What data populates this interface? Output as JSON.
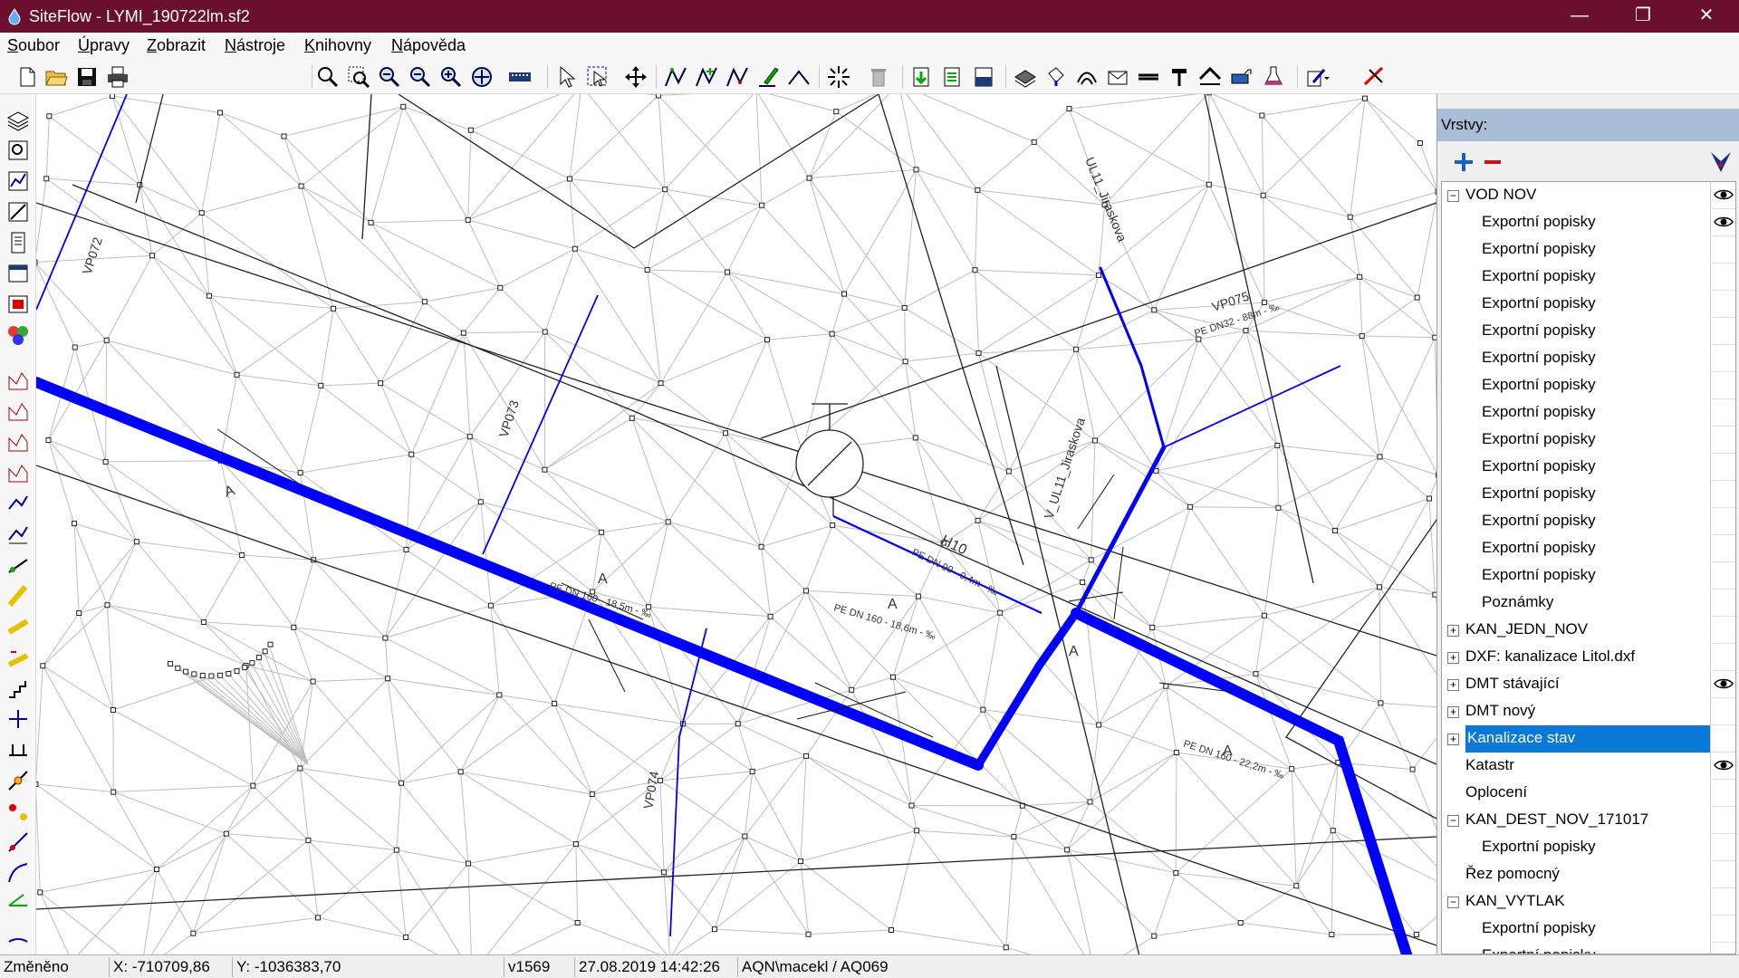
{
  "window": {
    "title": "SiteFlow - LYMI_190722lm.sf2"
  },
  "menu": [
    "Soubor",
    "Úpravy",
    "Zobrazit",
    "Nástroje",
    "Knihovny",
    "Nápověda"
  ],
  "layers": {
    "title": "Vrstvy:",
    "items": [
      {
        "label": "VOD NOV",
        "level": 0,
        "expander": "minus",
        "visible": true,
        "selected": false
      },
      {
        "label": "Exportní popisky",
        "level": 1,
        "visible": true,
        "selected": false
      },
      {
        "label": "Exportní popisky",
        "level": 1,
        "visible": false,
        "selected": false
      },
      {
        "label": "Exportní popisky",
        "level": 1,
        "visible": false,
        "selected": false
      },
      {
        "label": "Exportní popisky",
        "level": 1,
        "visible": false,
        "selected": false
      },
      {
        "label": "Exportní popisky",
        "level": 1,
        "visible": false,
        "selected": false
      },
      {
        "label": "Exportní popisky",
        "level": 1,
        "visible": false,
        "selected": false
      },
      {
        "label": "Exportní popisky",
        "level": 1,
        "visible": false,
        "selected": false
      },
      {
        "label": "Exportní popisky",
        "level": 1,
        "visible": false,
        "selected": false
      },
      {
        "label": "Exportní popisky",
        "level": 1,
        "visible": false,
        "selected": false
      },
      {
        "label": "Exportní popisky",
        "level": 1,
        "visible": false,
        "selected": false
      },
      {
        "label": "Exportní popisky",
        "level": 1,
        "visible": false,
        "selected": false
      },
      {
        "label": "Exportní popisky",
        "level": 1,
        "visible": false,
        "selected": false
      },
      {
        "label": "Exportní popisky",
        "level": 1,
        "visible": false,
        "selected": false
      },
      {
        "label": "Exportní popisky",
        "level": 1,
        "visible": false,
        "selected": false
      },
      {
        "label": "Poznámky",
        "level": 1,
        "visible": false,
        "selected": false
      },
      {
        "label": "KAN_JEDN_NOV",
        "level": 0,
        "expander": "plus",
        "visible": false,
        "selected": false
      },
      {
        "label": "DXF: kanalizace Litol.dxf",
        "level": 0,
        "expander": "plus",
        "visible": false,
        "selected": false
      },
      {
        "label": "DMT stávající",
        "level": 0,
        "expander": "plus",
        "visible": true,
        "selected": false
      },
      {
        "label": "DMT nový",
        "level": 0,
        "expander": "plus",
        "visible": false,
        "selected": false
      },
      {
        "label": "Kanalizace stav",
        "level": 0,
        "expander": "plus",
        "visible": false,
        "selected": true
      },
      {
        "label": "Katastr",
        "level": 0,
        "visible": true,
        "selected": false
      },
      {
        "label": "Oplocení",
        "level": 0,
        "visible": false,
        "selected": false
      },
      {
        "label": "KAN_DEST_NOV_171017",
        "level": 0,
        "expander": "minus",
        "visible": false,
        "selected": false
      },
      {
        "label": "Exportní popisky",
        "level": 1,
        "visible": false,
        "selected": false
      },
      {
        "label": "Řez pomocný",
        "level": 0,
        "visible": false,
        "selected": false
      },
      {
        "label": "KAN_VYTLAK",
        "level": 0,
        "expander": "minus",
        "visible": false,
        "selected": false
      },
      {
        "label": "Exportní popisky",
        "level": 1,
        "visible": false,
        "selected": false
      },
      {
        "label": "Exportní popisky",
        "level": 1,
        "visible": false,
        "selected": false
      }
    ]
  },
  "map_labels": {
    "vp072": "VP072",
    "vp073": "VP073",
    "vp074": "VP074",
    "vp075": "VP075",
    "h10": "H10",
    "street1": "UL11_Jiraskova",
    "street2": "V_UL11_Jiraskova",
    "a1": "A",
    "a2": "A",
    "a3": "A",
    "a4": "A",
    "a5": "A",
    "pe1": "PE DN 160 - 18,6m - ‰",
    "pe2": "PE DN 160 - 22,2m - ‰",
    "pe3": "PE DN 90 - 9,4m - ‰",
    "pe4": "PE DN32 - 88m - ‰",
    "pe5": "PE DN 160 - 18,5m - ‰"
  },
  "status": {
    "state": "Změněno",
    "x": "X: -710709,86",
    "y": "Y: -1036383,70",
    "version": "v1569",
    "datetime": "27.08.2019 14:42:26",
    "user": "AQN\\macekl / AQ069"
  },
  "colors": {
    "titlebar": "#6b0f2f",
    "pipe": "#0000ff",
    "selection": "#0a78d7"
  }
}
